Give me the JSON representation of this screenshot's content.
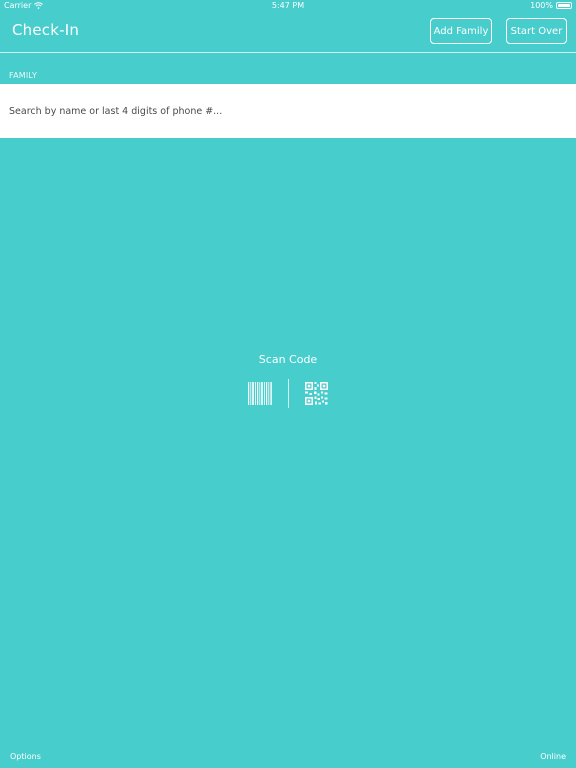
{
  "status_bar": {
    "carrier": "Carrier",
    "time": "5:47 PM",
    "battery": "100%"
  },
  "nav": {
    "title": "Check-In",
    "add_family_label": "Add Family",
    "start_over_label": "Start Over"
  },
  "family_section": {
    "label": "FAMILY",
    "search_placeholder": "Search by name or last 4 digits of phone #...",
    "search_value": ""
  },
  "scan": {
    "title": "Scan Code",
    "barcode_icon": "barcode-icon",
    "qr_icon": "qr-code-icon"
  },
  "footer": {
    "options_label": "Options",
    "connection_status": "Online"
  },
  "colors": {
    "background": "#48CDCD",
    "foreground": "#FFFFFF",
    "search_bg": "#FFFFFF"
  }
}
